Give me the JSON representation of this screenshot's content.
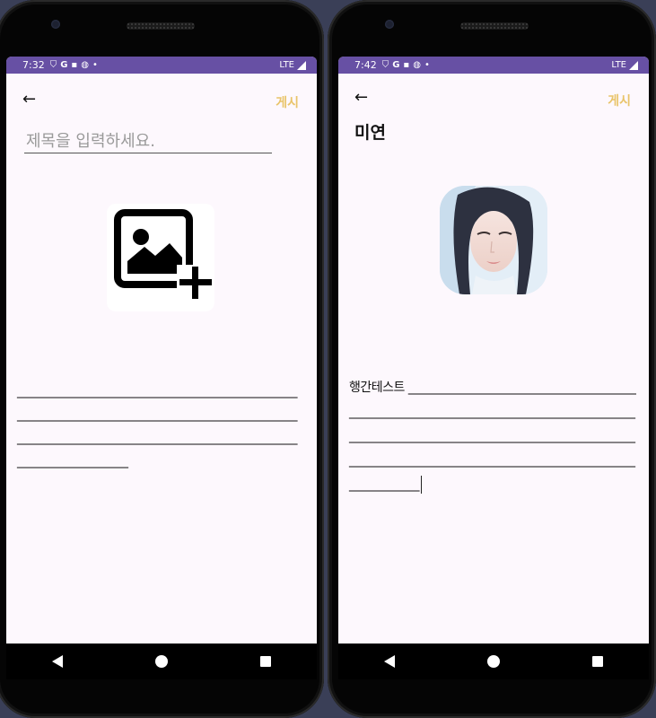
{
  "left_screen": {
    "status": {
      "time": "7:32",
      "network": "LTE"
    },
    "back_label": "←",
    "post_label": "게시",
    "title_placeholder": "제목을 입력하세요.",
    "content_text": "___________________________________________________________________________________________________________________________________________________________________"
  },
  "right_screen": {
    "status": {
      "time": "7:42",
      "network": "LTE"
    },
    "back_label": "←",
    "post_label": "게시",
    "title": "미연",
    "content_text": "행간테스트 ______________________________________________________________________________________________________________________________________________________________________________________________________"
  },
  "colors": {
    "status_bar": "#6750a4",
    "post_accent": "#e9c46a",
    "screen_bg": "#fdf8fd"
  }
}
